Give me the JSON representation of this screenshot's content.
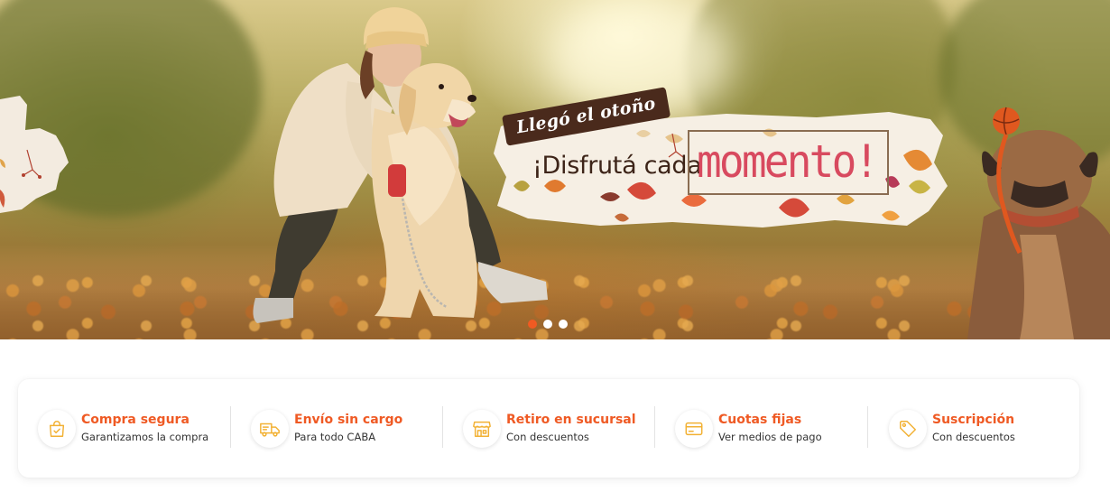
{
  "hero": {
    "tagline": "Llegó el otoño",
    "headline_prefix": "¡Disfrutá cada",
    "headline_highlight": "momento!",
    "carousel": {
      "slide_count": 3,
      "active_index": 0
    }
  },
  "features": [
    {
      "title": "Compra segura",
      "subtitle": "Garantizamos la compra",
      "icon": "shopping-bag-check-icon"
    },
    {
      "title": "Envío sin cargo",
      "subtitle": "Para todo CABA",
      "icon": "delivery-truck-icon"
    },
    {
      "title": "Retiro en sucursal",
      "subtitle": "Con descuentos",
      "icon": "store-icon"
    },
    {
      "title": "Cuotas fijas",
      "subtitle": "Ver medios de pago",
      "icon": "credit-card-icon"
    },
    {
      "title": "Suscripción",
      "subtitle": "Con descuentos",
      "icon": "price-tag-icon"
    }
  ],
  "colors": {
    "accent": "#ef5a24",
    "icon": "#f2b134",
    "headline_highlight": "#d84a5f",
    "tag_background": "#4a2a1c"
  }
}
